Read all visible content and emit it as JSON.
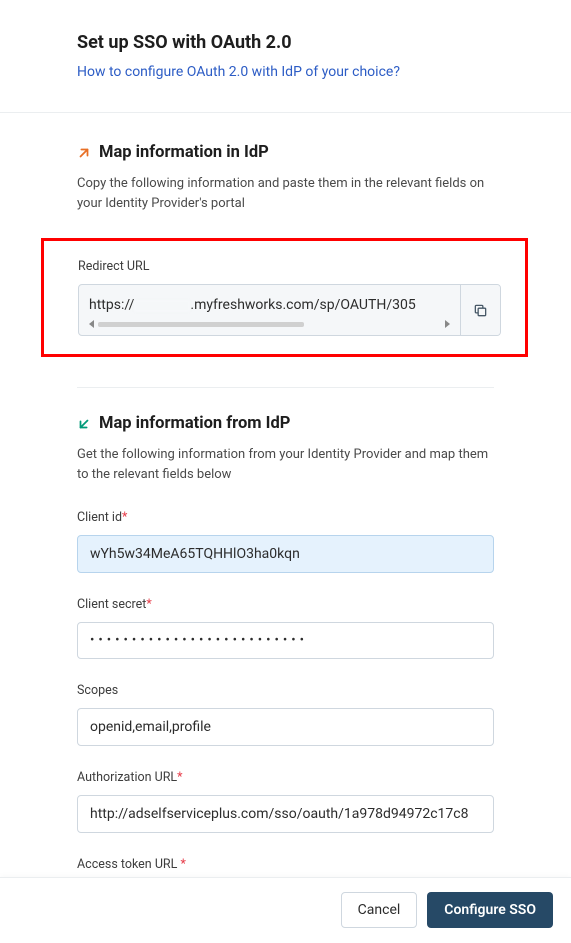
{
  "header": {
    "title": "Set up SSO with OAuth 2.0",
    "help_link": "How to configure OAuth 2.0 with IdP of your choice?"
  },
  "section_in": {
    "title": "Map information in IdP",
    "desc": "Copy the following information and paste them in the relevant fields on your Identity Provider's portal",
    "redirect_label": "Redirect URL",
    "redirect_url_part1": "https://",
    "redirect_url_part2": ".myfreshworks.com/sp/OAUTH/305"
  },
  "section_from": {
    "title": "Map information from IdP",
    "desc": "Get the following information from your Identity Provider and map them to the relevant fields below",
    "fields": {
      "client_id": {
        "label": "Client id",
        "value": "wYh5w34MeA65TQHHlO3ha0kqn"
      },
      "client_secret": {
        "label": "Client secret",
        "value": "••••••••••••••••••••••••••"
      },
      "scopes": {
        "label": "Scopes",
        "value": "openid,email,profile"
      },
      "auth_url": {
        "label": "Authorization URL",
        "value": "http://adselfserviceplus.com/sso/oauth/1a978d94972c17c8"
      },
      "access_token": {
        "label": "Access token URL"
      }
    }
  },
  "footer": {
    "cancel": "Cancel",
    "configure": "Configure SSO"
  },
  "colors": {
    "accent_link": "#2c5cc5",
    "arrow_out": "#e86f25",
    "arrow_in": "#009a79",
    "primary_btn": "#264966",
    "highlight_border": "#ff0000"
  }
}
